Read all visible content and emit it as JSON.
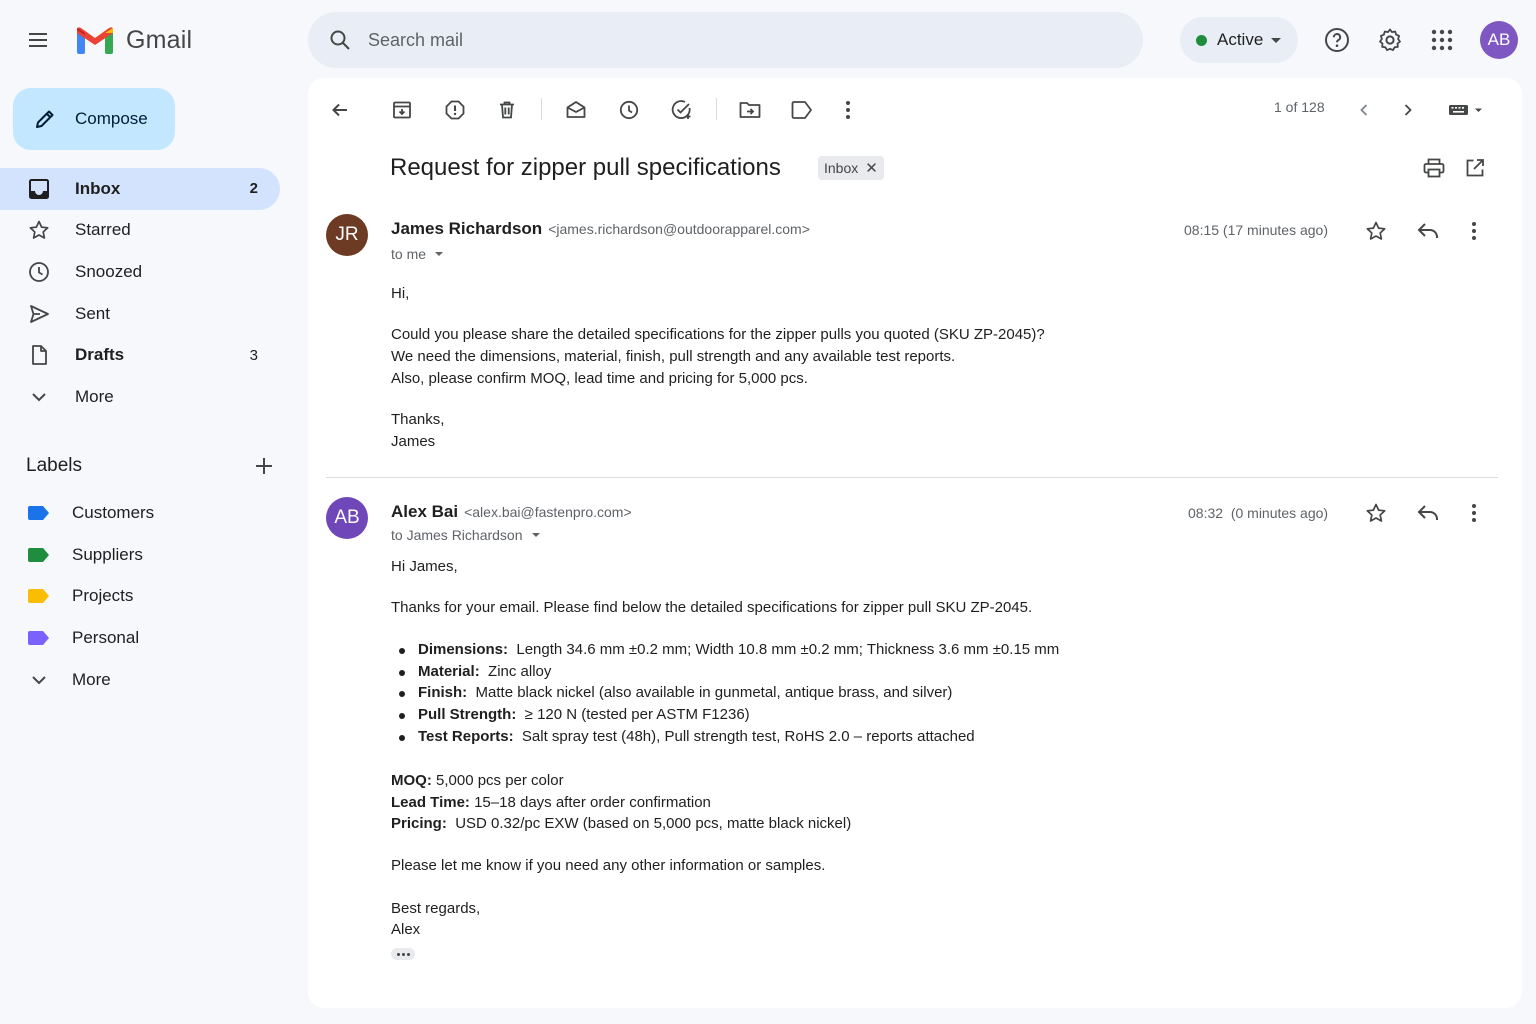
{
  "app": {
    "name": "Gmail"
  },
  "search": {
    "placeholder": "Search mail"
  },
  "status": {
    "label": "Active",
    "color": "#1e8e3e"
  },
  "user": {
    "initials": "AB",
    "avatar_color": "#7e57c2"
  },
  "compose": {
    "label": "Compose"
  },
  "nav": {
    "items": [
      {
        "label": "Inbox",
        "count": "2"
      },
      {
        "label": "Starred",
        "count": ""
      },
      {
        "label": "Snoozed",
        "count": ""
      },
      {
        "label": "Sent",
        "count": ""
      },
      {
        "label": "Drafts",
        "count": "3"
      },
      {
        "label": "More",
        "count": ""
      }
    ]
  },
  "labels": {
    "title": "Labels",
    "items": [
      {
        "label": "Customers",
        "color": "#1a73e8"
      },
      {
        "label": "Suppliers",
        "color": "#1e8e3e"
      },
      {
        "label": "Projects",
        "color": "#fbbc04"
      },
      {
        "label": "Personal",
        "color": "#7b61ff"
      }
    ],
    "more": "More"
  },
  "toolbar": {
    "pager": "1 of 128"
  },
  "thread": {
    "subject": "Request for zipper pull specifications",
    "chip": "Inbox",
    "messages": [
      {
        "initials": "JR",
        "avatar_color": "#6d3a23",
        "sender": "James Richardson",
        "email": "<james.richardson@outdoorapparel.com>",
        "to": "to me",
        "time": "08:15 (17 minutes ago)",
        "greeting": "Hi,",
        "lines": [
          "Could you please share the detailed specifications for the zipper pulls you quoted (SKU ZP-2045)?",
          "We need the dimensions, material, finish, pull strength and any available test reports.",
          "Also, please confirm MOQ, lead time and pricing for 5,000 pcs."
        ],
        "signoff": [
          "Thanks,",
          "James"
        ]
      },
      {
        "initials": "AB",
        "avatar_color": "#6f47b8",
        "sender": "Alex Bai",
        "email": "<alex.bai@fastenpro.com>",
        "to": "to James Richardson",
        "time": "08:32  (0 minutes ago)",
        "greeting": "Hi James,",
        "intro": "Thanks for your email. Please find below the detailed specifications for zipper pull SKU ZP-2045.",
        "specs": [
          {
            "key": "Dimensions:",
            "value": "Length 34.6 mm ±0.2 mm; Width 10.8 mm ±0.2 mm; Thickness 3.6 mm ±0.15 mm"
          },
          {
            "key": "Material:",
            "value": "Zinc alloy"
          },
          {
            "key": "Finish:",
            "value": "Matte black nickel (also available in gunmetal, antique brass, and silver)"
          },
          {
            "key": "Pull Strength:",
            "value": "≥ 120 N (tested per ASTM F1236)"
          },
          {
            "key": "Test Reports:",
            "value": "Salt spray test (48h), Pull strength test, RoHS 2.0 – reports attached"
          }
        ],
        "terms": [
          {
            "key": "MOQ:",
            "value": "5,000 pcs per color"
          },
          {
            "key": "Lead Time:",
            "value": "15–18 days after order confirmation"
          },
          {
            "key": "Pricing:",
            "value": "USD 0.32/pc EXW (based on 5,000 pcs, matte black nickel)"
          }
        ],
        "closing": "Please let me know if you need any other information or samples.",
        "signoff": [
          "Best regards,",
          "Alex"
        ]
      }
    ]
  }
}
